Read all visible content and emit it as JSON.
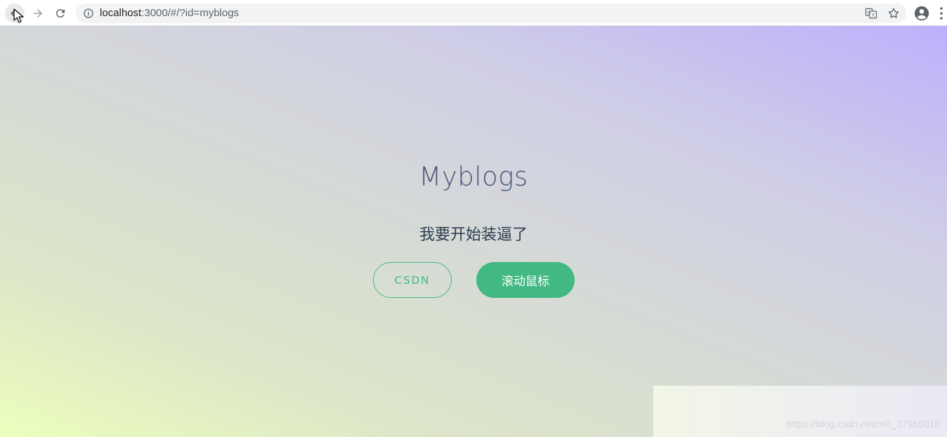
{
  "browser": {
    "url_host": "localhost",
    "url_rest": ":3000/#/?id=myblogs",
    "icons": {
      "back": "arrow-left-icon",
      "forward": "arrow-right-icon",
      "reload": "reload-icon",
      "info": "info-icon",
      "translate": "translate-icon",
      "bookmark": "star-icon",
      "account": "account-icon",
      "menu": "kebab-menu-icon"
    }
  },
  "hero": {
    "title": "Myblogs",
    "subtitle": "我要开始装逼了",
    "buttons": {
      "csdn_label": "CSDN",
      "scroll_label": "滚动鼠标"
    }
  },
  "watermark": "https://blog.csdn.net/m0_37965018",
  "colors": {
    "accent": "#42b983",
    "title": "#4a5877",
    "subtitle": "#2c3e50"
  }
}
